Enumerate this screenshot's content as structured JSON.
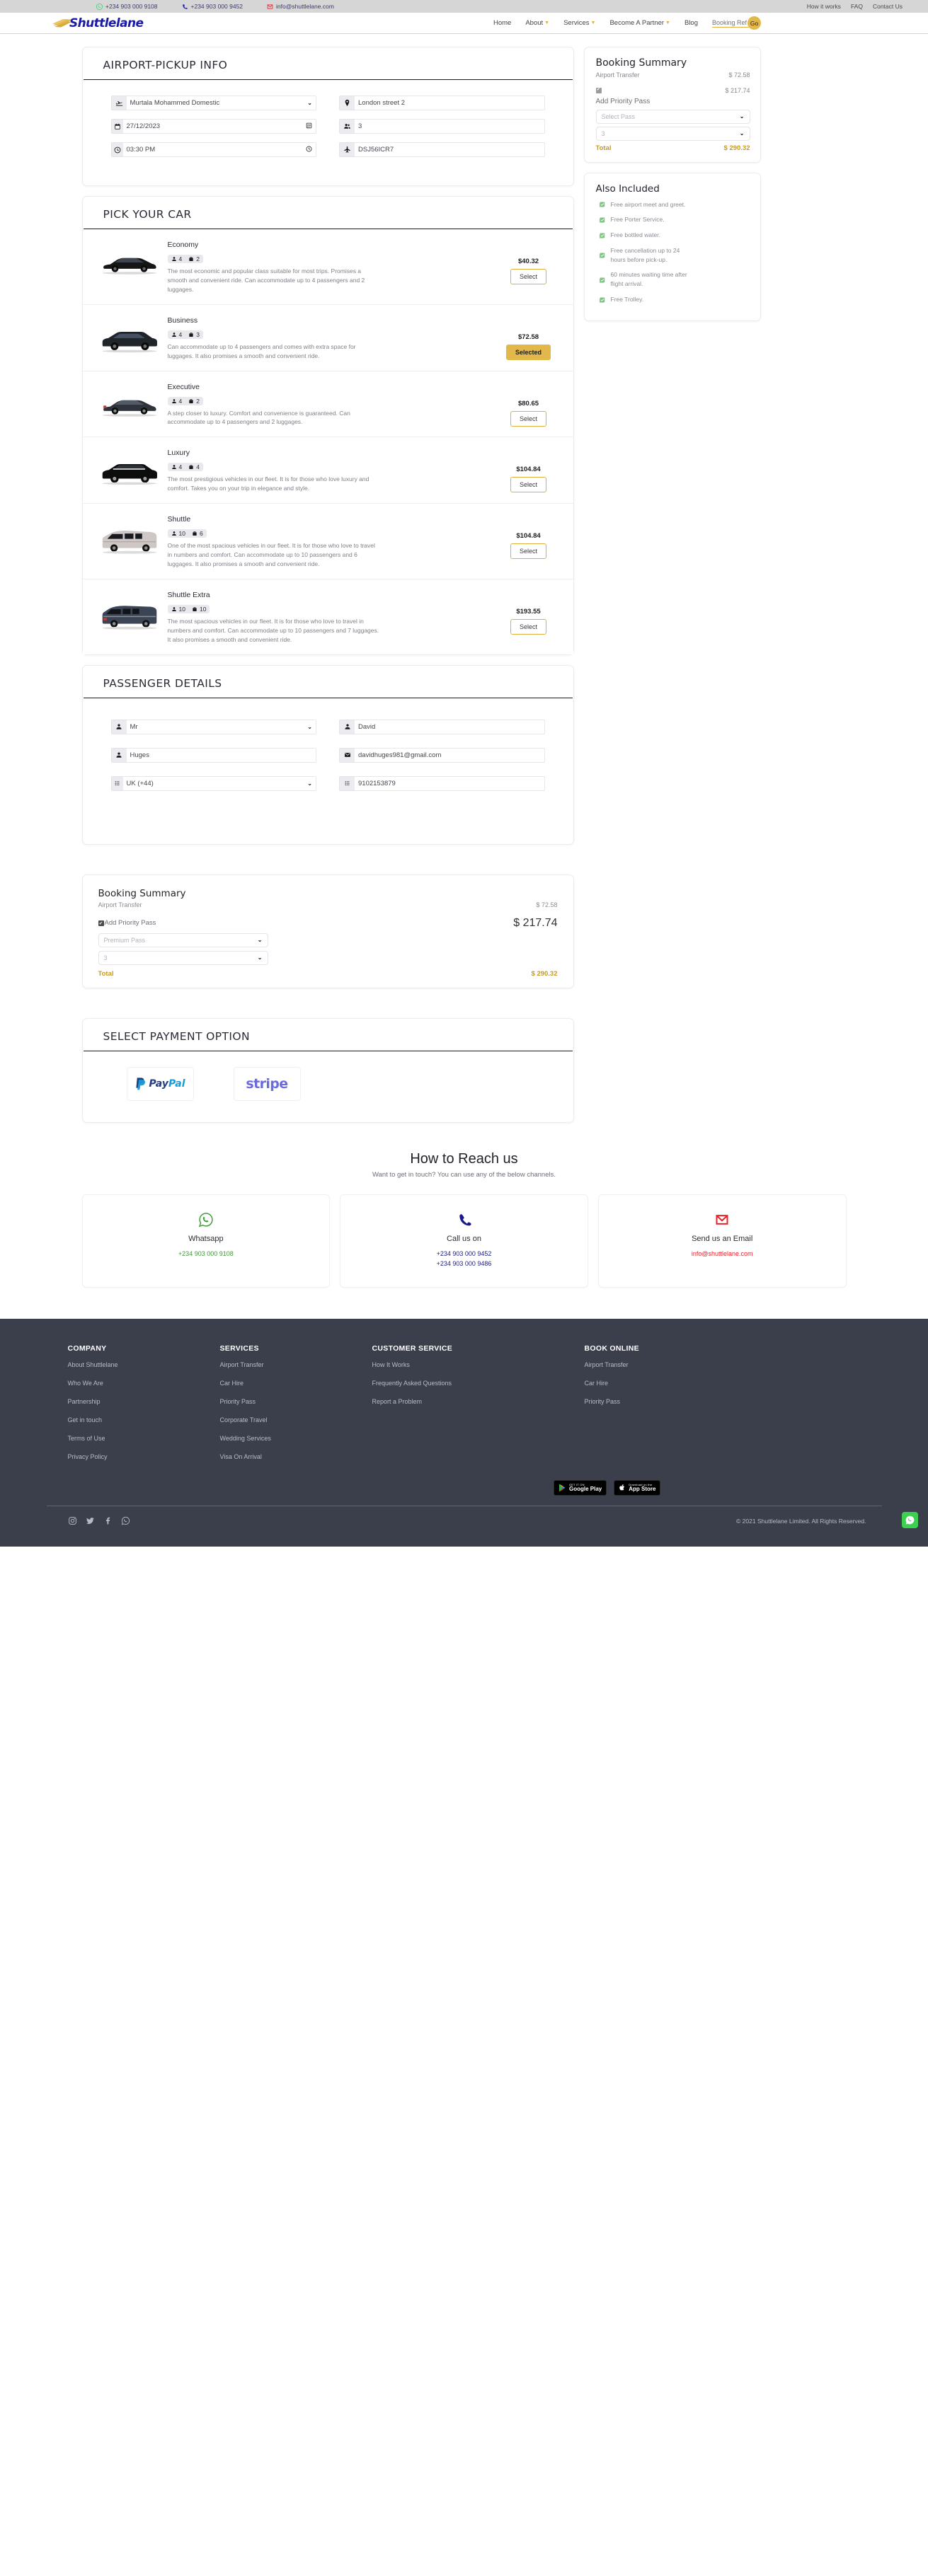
{
  "topbar": {
    "phone_whatsapp": "+234 903 000 9108",
    "phone_call": "+234 903 000 9452",
    "email": "info@shuttlelane.com",
    "links": [
      "How it works",
      "FAQ",
      "Contact Us"
    ]
  },
  "nav": {
    "brand": "Shuttlelane",
    "items": [
      {
        "label": "Home",
        "caret": false
      },
      {
        "label": "About",
        "caret": true
      },
      {
        "label": "Services",
        "caret": true
      },
      {
        "label": "Become A Partner",
        "caret": true
      },
      {
        "label": "Blog",
        "caret": false
      }
    ],
    "booking_ref_placeholder": "Booking Ref",
    "go_label": "Go",
    "accent": "#e3b84a"
  },
  "pickup": {
    "heading": "AIRPORT-PICKUP INFO",
    "fields": [
      {
        "icon": "plane-landing-icon",
        "name": "airport-select",
        "value": "Murtala Mohammed Domestic",
        "type": "select"
      },
      {
        "icon": "map-pin-icon",
        "name": "dropoff-address-input",
        "value": "London street 2",
        "type": "text"
      },
      {
        "icon": "calendar-icon",
        "name": "pickup-date-input",
        "value": "27/12/2023",
        "type": "date"
      },
      {
        "icon": "passengers-icon",
        "name": "passenger-count-input",
        "value": "3",
        "type": "text"
      },
      {
        "icon": "clock-icon",
        "name": "pickup-time-input",
        "value": "03:30 PM",
        "type": "time"
      },
      {
        "icon": "plane-icon",
        "name": "flight-number-input",
        "value": "DSJ56ICR7",
        "type": "text"
      }
    ]
  },
  "cars": {
    "heading": "PICK YOUR CAR",
    "select_label": "Select",
    "selected_label": "Selected",
    "items": [
      {
        "name": "Economy",
        "passengers": "4",
        "luggage": "2",
        "price": "$40.32",
        "desc": "The most economic and popular class suitable for most trips. Promises a smooth and convenient ride. Can accommodate up to 4 passengers and 2 luggages.",
        "state": "select",
        "image": "sedan-black-icon"
      },
      {
        "name": "Business",
        "passengers": "4",
        "luggage": "3",
        "price": "$72.58",
        "desc": "Can accommodate up to 4 passengers and comes with extra space for luggages. It also promises a smooth and convenient ride.",
        "state": "selected",
        "image": "suv-dark-icon"
      },
      {
        "name": "Executive",
        "passengers": "4",
        "luggage": "2",
        "price": "$80.65",
        "desc": "A step closer to luxury. Comfort and convenience is guaranteed. Can accommodate up to 4 passengers and 2 luggages.",
        "state": "select",
        "image": "sedan-grey-icon"
      },
      {
        "name": "Luxury",
        "passengers": "4",
        "luggage": "4",
        "price": "$104.84",
        "desc": "The most prestigious vehicles in our fleet. It is for those who love luxury and comfort. Takes you on your trip in elegance and style.",
        "state": "select",
        "image": "suv-luxury-icon"
      },
      {
        "name": "Shuttle",
        "passengers": "10",
        "luggage": "6",
        "price": "$104.84",
        "desc": "One of the most spacious vehicles in our fleet. It is for those who love to travel in numbers and comfort. Can accommodate up to 10 passengers and 6 luggages. It also promises a smooth and convenient ride.",
        "state": "select",
        "image": "van-white-icon"
      },
      {
        "name": "Shuttle Extra",
        "passengers": "10",
        "luggage": "10",
        "price": "$193.55",
        "desc": "The most spacious vehicles in our fleet. It is for those who love to travel in numbers and comfort. Can accommodate up to 10 passengers and 7 luggages. It also promises a smooth and convenient ride.",
        "state": "select",
        "image": "van-blue-icon"
      }
    ]
  },
  "sidebar_summary": {
    "title": "Booking Summary",
    "service_label": "Airport Transfer",
    "service_price": "$ 72.58",
    "priority_price": "$ 217.74",
    "priority_label": "Add Priority Pass",
    "pass_select_value": "Select Pass",
    "pass_count_value": "3",
    "total_label": "Total",
    "total_value": "$ 290.32",
    "accent": "#c59a22"
  },
  "also_included": {
    "title": "Also Included",
    "items": [
      "Free airport meet and greet.",
      "Free Porter Service.",
      "Free bottled water.",
      "Free cancellation up to 24 hours before pick-up.",
      "60 minutes waiting time after flight arrival.",
      "Free Trolley."
    ],
    "check_color": "#7cc47f"
  },
  "passenger": {
    "heading": "PASSENGER DETAILS",
    "fields": [
      {
        "icon": "person-icon",
        "name": "title-select",
        "value": "Mr",
        "type": "select"
      },
      {
        "icon": "person-icon",
        "name": "first-name-input",
        "value": "David",
        "type": "text"
      },
      {
        "icon": "person-icon",
        "name": "last-name-input",
        "value": "Huges",
        "type": "text"
      },
      {
        "icon": "envelope-icon",
        "name": "email-input",
        "value": "davidhuges981@gmail.com",
        "type": "text"
      },
      {
        "icon": "keypad-icon",
        "name": "country-code-select",
        "value": "UK (+44)",
        "type": "select"
      },
      {
        "icon": "keypad-icon",
        "name": "phone-input",
        "value": "9102153879",
        "type": "text"
      }
    ]
  },
  "lower_summary": {
    "title": "Booking Summary",
    "service_label": "Airport Transfer",
    "service_price": "$ 72.58",
    "priority_label": "Add Priority Pass",
    "priority_price": "$ 217.74",
    "pass_select_value": "Premium Pass",
    "pass_count_value": "3",
    "total_label": "Total",
    "total_value": "$ 290.32"
  },
  "payment": {
    "heading": "SELECT PAYMENT OPTION",
    "options": [
      {
        "name": "paypal-option",
        "label": "PayPal"
      },
      {
        "name": "stripe-option",
        "label": "stripe"
      }
    ]
  },
  "reach": {
    "title": "How to Reach us",
    "subtitle": "Want to get in touch? You can use any of the below channels.",
    "cards": [
      {
        "icon": "whatsapp-icon",
        "title": "Whatsapp",
        "lines": [
          "+234 903 000 9108"
        ],
        "color": "#3f9c35"
      },
      {
        "icon": "phone-icon",
        "title": "Call us on",
        "lines": [
          "+234 903 000 9452",
          "+234 903 000 9486"
        ],
        "color": "#1a1a8c"
      },
      {
        "icon": "email-icon",
        "title": "Send us an Email",
        "lines": [
          "info@shuttlelane.com"
        ],
        "color": "#e8202a"
      }
    ]
  },
  "footer": {
    "columns": [
      {
        "heading": "COMPANY",
        "links": [
          "About Shuttlelane",
          "Who We Are",
          "Partnership",
          "Get in touch",
          "Terms of Use",
          "Privacy Policy"
        ]
      },
      {
        "heading": "SERVICES",
        "links": [
          "Airport Transfer",
          "Car Hire",
          "Priority Pass",
          "Corporate Travel",
          "Wedding Services",
          "Visa On Arrival"
        ]
      },
      {
        "heading": "CUSTOMER SERVICE",
        "links": [
          "How It Works",
          "Frequently Asked Questions",
          "Report a Problem"
        ]
      },
      {
        "heading": "BOOK ONLINE",
        "links": [
          "Airport Transfer",
          "Car Hire",
          "Priority Pass"
        ]
      }
    ],
    "stores": [
      {
        "name": "google-play-badge",
        "small": "GET IT ON",
        "big": "Google Play"
      },
      {
        "name": "app-store-badge",
        "small": "Download on the",
        "big": "App Store"
      }
    ],
    "socials": [
      "instagram-icon",
      "twitter-icon",
      "facebook-icon",
      "whatsapp-icon"
    ],
    "copyright": "© 2021 Shuttlelane Limited. All Rights Reserved.",
    "bg": "#3a3f4b"
  }
}
